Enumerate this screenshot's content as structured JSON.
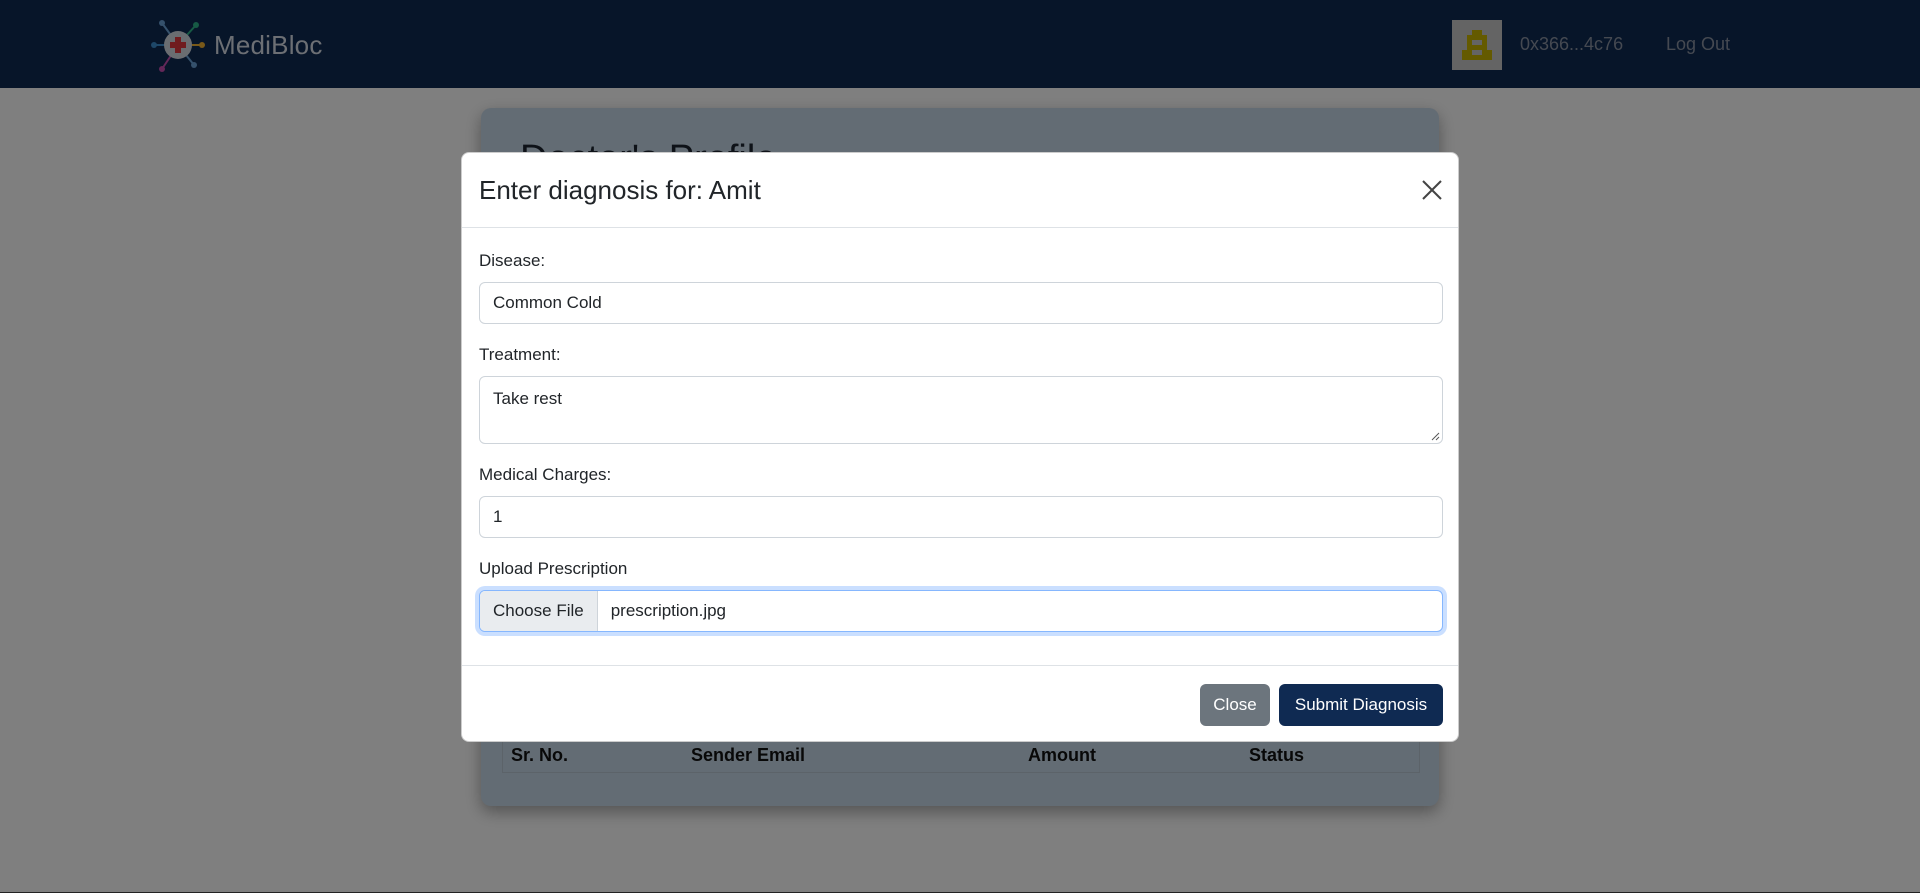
{
  "app": {
    "brand": "MediBloc",
    "wallet_address": "0x366...4c76",
    "logout": "Log Out"
  },
  "page": {
    "profile_title": "Doctor's Profile",
    "table_headers": [
      "Sr. No.",
      "Sender Email",
      "Amount",
      "Status"
    ]
  },
  "modal": {
    "title": "Enter diagnosis for: Amit",
    "fields": {
      "disease_label": "Disease:",
      "disease_value": "Common Cold",
      "treatment_label": "Treatment:",
      "treatment_value": "Take rest",
      "charges_label": "Medical Charges:",
      "charges_value": "1",
      "upload_label": "Upload Prescription",
      "choose_file": "Choose File",
      "file_name": "prescription.jpg"
    },
    "buttons": {
      "close": "Close",
      "submit": "Submit Diagnosis"
    }
  },
  "colors": {
    "navbar": "#0f2a52",
    "primary_button": "#0f2a52",
    "secondary_button": "#6c757d",
    "profile_card": "#c7d9e8"
  },
  "icons": {
    "brand_logo": "medical-network-icon",
    "avatar": "identicon",
    "close": "close-icon"
  }
}
